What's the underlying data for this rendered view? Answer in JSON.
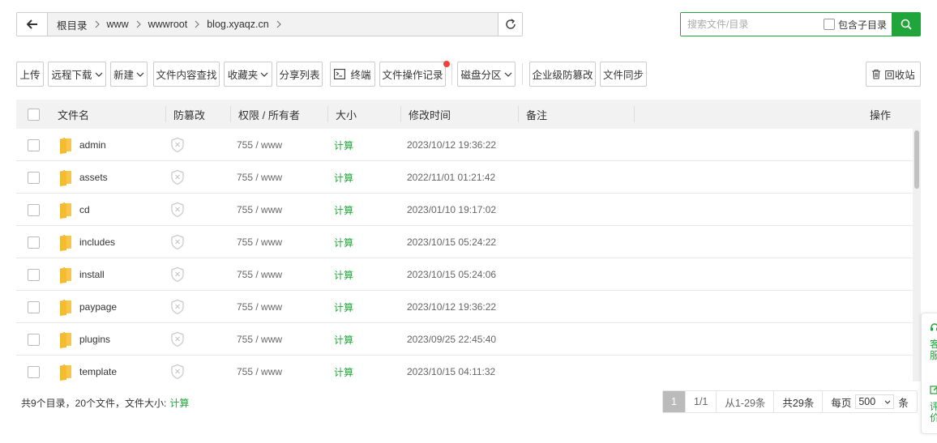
{
  "breadcrumb": {
    "items": [
      "根目录",
      "www",
      "wwwroot",
      "blog.xyaqz.cn"
    ]
  },
  "search": {
    "placeholder": "搜索文件/目录",
    "subdir_label": "包含子目录"
  },
  "toolbar": {
    "upload": "上传",
    "remote_download": "远程下载",
    "new": "新建",
    "content_search": "文件内容查找",
    "favorites": "收藏夹",
    "share_list": "分享列表",
    "terminal": "终端",
    "operation_log": "文件操作记录",
    "disk_partition": "磁盘分区",
    "enterprise_tamper": "企业级防篡改",
    "file_sync": "文件同步",
    "recycle_bin": "回收站"
  },
  "table": {
    "columns": {
      "name": "文件名",
      "tamper": "防篡改",
      "perm_owner": "权限 / 所有者",
      "size": "大小",
      "mtime": "修改时间",
      "remark": "备注",
      "actions": "操作"
    },
    "rows": [
      {
        "name": "admin",
        "perm": "755 / www",
        "size": "计算",
        "mtime": "2023/10/12 19:36:22"
      },
      {
        "name": "assets",
        "perm": "755 / www",
        "size": "计算",
        "mtime": "2022/11/01 01:21:42"
      },
      {
        "name": "cd",
        "perm": "755 / www",
        "size": "计算",
        "mtime": "2023/01/10 19:17:02"
      },
      {
        "name": "includes",
        "perm": "755 / www",
        "size": "计算",
        "mtime": "2023/10/15 05:24:22"
      },
      {
        "name": "install",
        "perm": "755 / www",
        "size": "计算",
        "mtime": "2023/10/15 05:24:06"
      },
      {
        "name": "paypage",
        "perm": "755 / www",
        "size": "计算",
        "mtime": "2023/10/12 19:36:22"
      },
      {
        "name": "plugins",
        "perm": "755 / www",
        "size": "计算",
        "mtime": "2023/09/25 22:45:40"
      },
      {
        "name": "template",
        "perm": "755 / www",
        "size": "计算",
        "mtime": "2023/10/15 04:11:32"
      }
    ]
  },
  "footer": {
    "summary": "共9个目录，20个文件，文件大小:",
    "calc_link": "计算",
    "page_current": "1",
    "page_of": "1/1",
    "range": "从1-29条",
    "total": "共29条",
    "per_page_label": "每页",
    "per_page_value": "500",
    "per_page_unit": "条"
  },
  "side_float": {
    "service": "客服",
    "rate": "评价"
  },
  "colors": {
    "accent": "#20a53a",
    "badge_dot": "#f0433a"
  }
}
